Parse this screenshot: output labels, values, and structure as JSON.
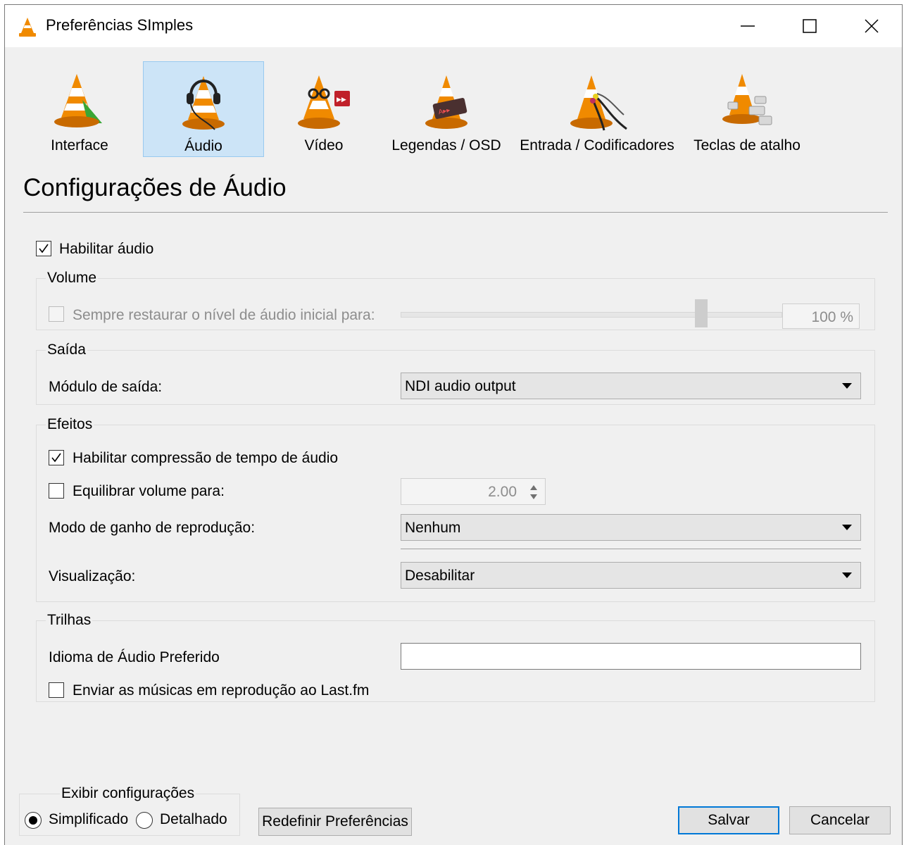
{
  "window": {
    "title": "Preferências SImples",
    "controls": [
      "minimize-icon",
      "maximize-icon",
      "close-icon"
    ]
  },
  "categories": [
    {
      "label": "Interface",
      "icon": "vlc-cone-interface-icon",
      "selected": false
    },
    {
      "label": "Áudio",
      "icon": "vlc-cone-headphones-icon",
      "selected": true
    },
    {
      "label": "Vídeo",
      "icon": "vlc-cone-glasses-icon",
      "selected": false
    },
    {
      "label": "Legendas / OSD",
      "icon": "vlc-cone-subtitles-icon",
      "selected": false
    },
    {
      "label": "Entrada / Codificadores",
      "icon": "vlc-cone-cables-icon",
      "selected": false
    },
    {
      "label": "Teclas de atalho",
      "icon": "vlc-cone-keys-icon",
      "selected": false
    }
  ],
  "section_title": "Configurações de Áudio",
  "enable_audio": {
    "label": "Habilitar áudio",
    "checked": true
  },
  "volume": {
    "title": "Volume",
    "restore_label": "Sempre restaurar o nível de áudio inicial para:",
    "restore_checked": false,
    "slider_level": 0.75,
    "value": "100 %"
  },
  "output": {
    "title": "Saída",
    "module_label": "Módulo de saída:",
    "module_value": "NDI audio output"
  },
  "effects": {
    "title": "Efeitos",
    "stretch_label": "Habilitar compressão de tempo de áudio",
    "stretch_checked": true,
    "normalize_label": "Equilibrar volume para:",
    "normalize_checked": false,
    "normalize_value": "2.00",
    "replaygain_label": "Modo de ganho de reprodução:",
    "replaygain_value": "Nenhum",
    "visual_label": "Visualização:",
    "visual_value": "Desabilitar"
  },
  "tracks": {
    "title": "Trilhas",
    "language_label": "Idioma de Áudio Preferido",
    "language_value": "",
    "lastfm_label": "Enviar as músicas em reprodução ao Last.fm",
    "lastfm_checked": false
  },
  "show_settings": {
    "title": "Exibir configurações",
    "simple_label": "Simplificado",
    "advanced_label": "Detalhado",
    "selected": "simple"
  },
  "buttons": {
    "reset": "Redefinir Preferências",
    "save": "Salvar",
    "cancel": "Cancelar"
  },
  "colors": {
    "selection": "#cce4f7",
    "cone_orange": "#f08a00",
    "default_button_border": "#0078d7"
  }
}
